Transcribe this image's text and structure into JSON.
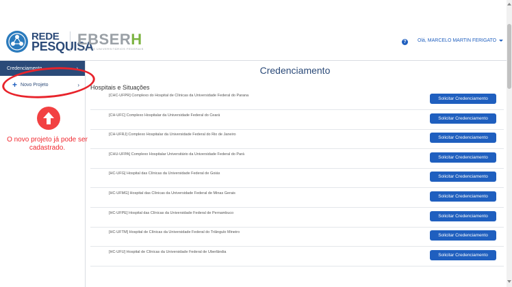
{
  "header": {
    "logo_rede_line1": "REDE",
    "logo_rede_line2": "PESQUISA",
    "logo_ebserh_main": "EBSER",
    "logo_ebserh_h": "H",
    "logo_ebserh_sub": "HOSPITAIS UNIVERSITÁRIOS FEDERAIS",
    "help_glyph": "?",
    "user_greeting": "Olá, MARCELO MARTIN FERIGATO"
  },
  "sidebar": {
    "items": [
      {
        "label": "Credenciamento",
        "icon": "chevron-right-icon"
      },
      {
        "label": "Novo Projeto",
        "icon": "plus-icon"
      }
    ],
    "chevron": "›"
  },
  "annotation": {
    "text": "O novo projeto já pode ser cadastrado."
  },
  "main": {
    "title": "Credenciamento",
    "section_title": "Hospitais e Situações",
    "button_label": "Solicitar Credenciamento",
    "hospitals": [
      "[CHC-UFPR] Complexo do Hospital de Clínicas da Universidade Federal do Parana",
      "[CH-UFC] Complexo Hospitalar da Universidade Federal do Ceará",
      "[CH-UFRJ] Complexo Hospitalar da Universidade Federal do Rio de Janeiro",
      "[CHU-UFPA] Complexo Hospitalar Universitário da Universidade Federal do Pará",
      "[HC-UFG] Hospital das Clínicas da Universidade Federal de Goiás",
      "[HC-UFMG] Hospital das Clínicas da Universidade Federal de Minas Gerais",
      "[HC-UFPE] Hospital das Clínicas da Universidade Federal de Pernambuco",
      "[HC-UFTM] Hospital de Clínicas da Universidade Federal do Triângulo Mineiro",
      "[HC-UFU] Hospital de Clínicas da Universidade Federal de Uberlândia"
    ]
  },
  "colors": {
    "brand_navy": "#2b4a78",
    "button_blue": "#1f5fbf",
    "annotation_red": "#f0282f",
    "ebserh_green": "#7cb342"
  }
}
